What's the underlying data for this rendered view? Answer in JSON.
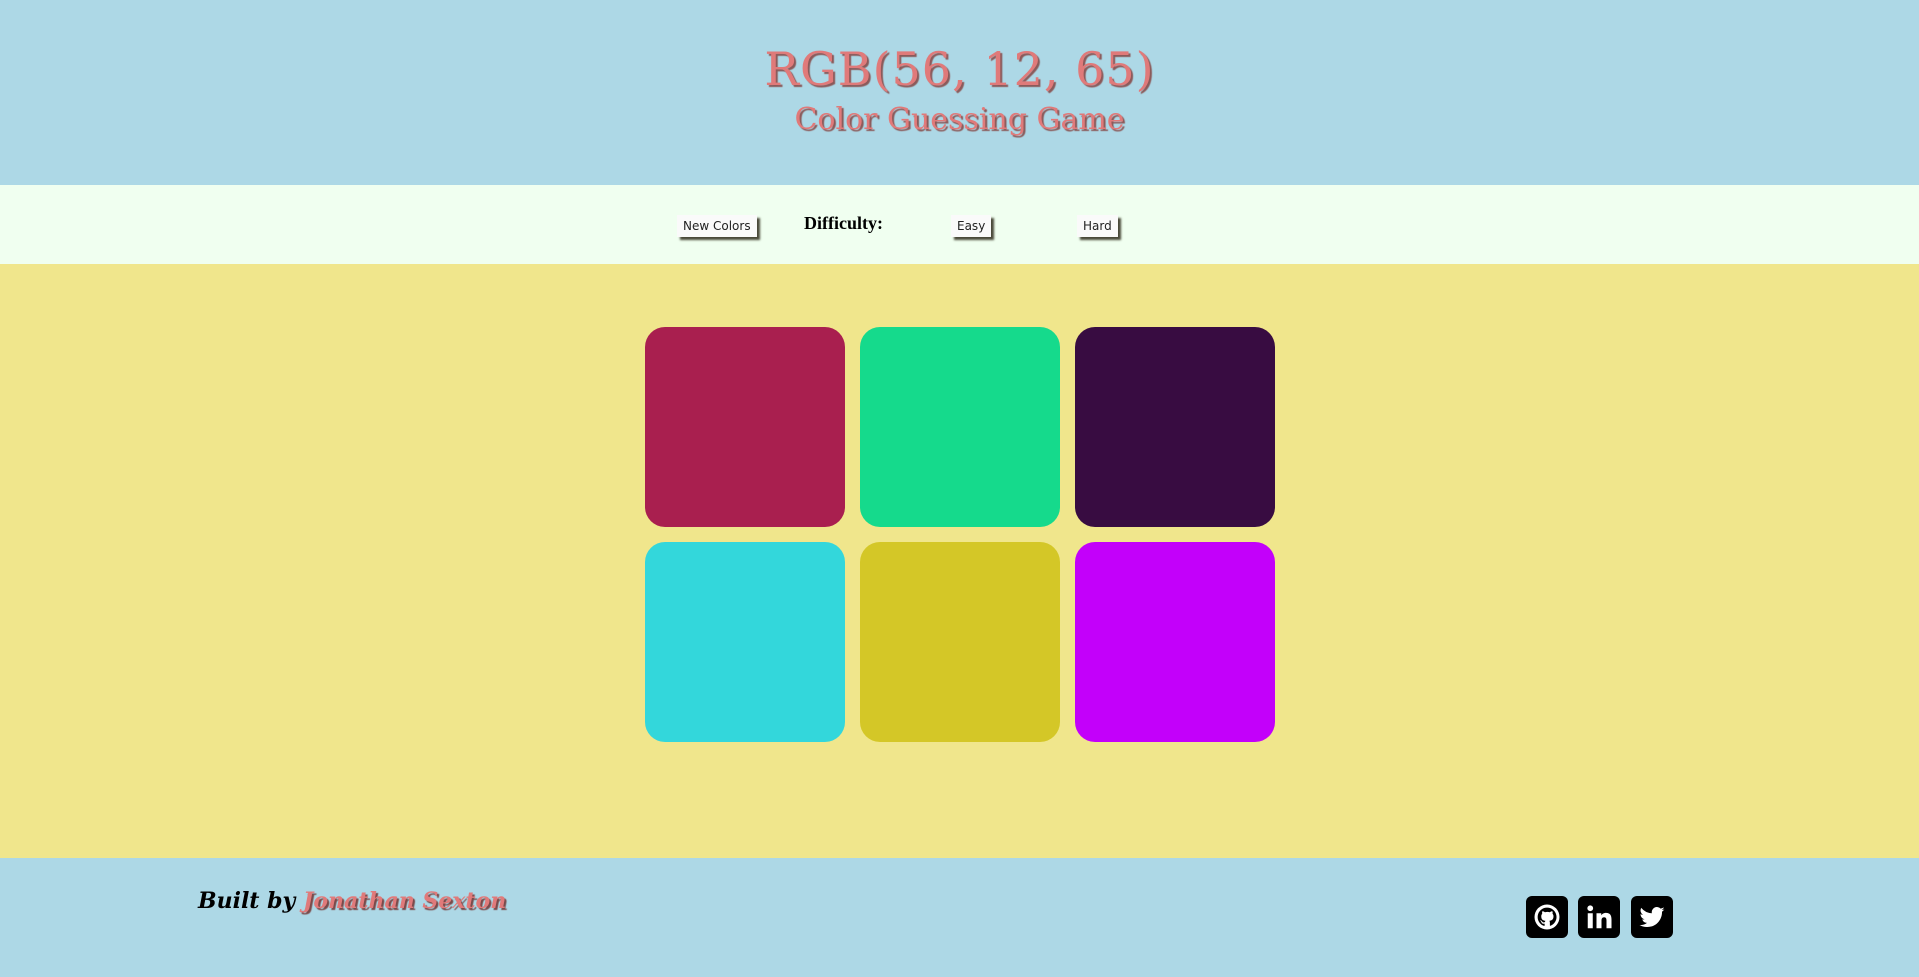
{
  "header": {
    "rgb_display": "RGB(56, 12, 65)",
    "subtitle": "Color Guessing Game"
  },
  "controls": {
    "new_colors_label": "New Colors",
    "difficulty_label": "Difficulty:",
    "easy_label": "Easy",
    "hard_label": "Hard"
  },
  "board": {
    "squares": [
      {
        "color": "#a91f4f"
      },
      {
        "color": "#15da8c"
      },
      {
        "color": "#380c41"
      },
      {
        "color": "#33d7db"
      },
      {
        "color": "#d4c727"
      },
      {
        "color": "#c300fa"
      }
    ]
  },
  "footer": {
    "built_by_label": "Built by",
    "author_name": "Jonathan Sexton",
    "social_links": [
      "github-icon",
      "linkedin-icon",
      "twitter-icon"
    ]
  },
  "colors": {
    "header_bg": "#add8e6",
    "controls_bg": "#f0fff0",
    "board_bg": "#f0e68c",
    "title_color": "#e07a7a"
  }
}
